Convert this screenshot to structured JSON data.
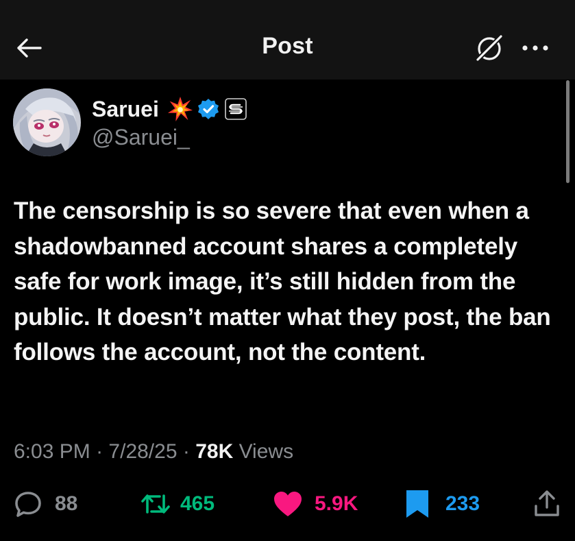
{
  "header": {
    "title": "Post"
  },
  "author": {
    "name": "Saruei",
    "handle": "@Saruei_"
  },
  "post": {
    "text": "The censorship is so severe that even when a shadowbanned account shares a completely safe for work image, it’s still hidden from the public. It doesn’t matter what they post, the ban follows the account, not the content.",
    "time": "6:03 PM",
    "date": "7/28/25",
    "separator": "·",
    "views_count": "78K",
    "views_label": "Views"
  },
  "actions": {
    "replies": "88",
    "reposts": "465",
    "likes": "5.9K",
    "bookmarks": "233"
  },
  "colors": {
    "background": "#000000",
    "header_bg": "#131313",
    "repost_green": "#00ba7c",
    "like_pink": "#f91880",
    "bookmark_blue": "#1d9bf0",
    "muted_text": "#8a8d91"
  },
  "icons": {
    "back": "arrow-left-icon",
    "grok": "grok-icon",
    "more": "more-dots-icon",
    "emoji": "collision-emoji-icon",
    "verified": "verified-badge-icon",
    "affiliate": "affiliate-badge-icon",
    "reply": "reply-bubble-icon",
    "repost": "repost-icon",
    "like": "heart-icon",
    "bookmark": "bookmark-icon",
    "share": "share-icon"
  }
}
